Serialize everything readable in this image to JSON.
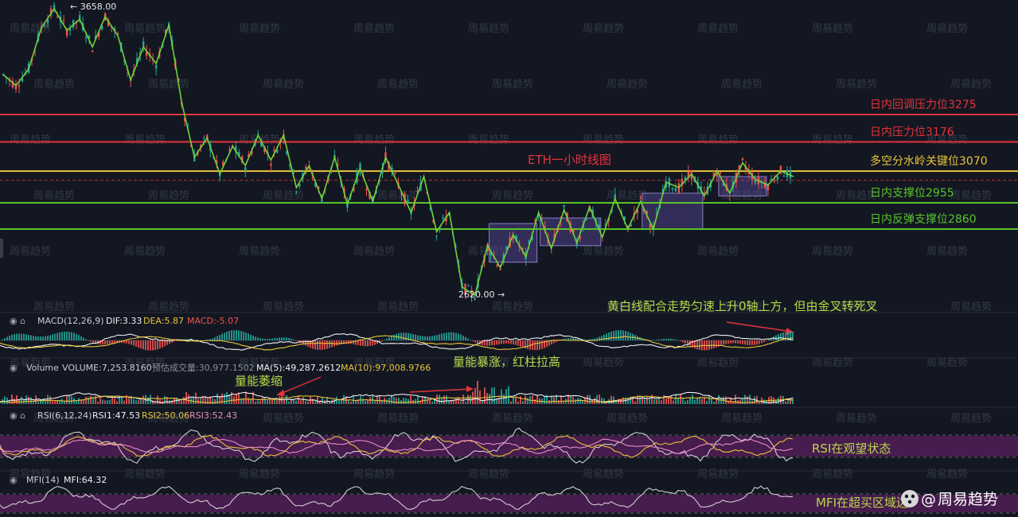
{
  "chart_data": {
    "type": "candlestick",
    "title": "ETH一小时线图",
    "price_extremes": {
      "high": "3658.00",
      "low": "2620.00"
    },
    "levels": [
      {
        "label": "日内回调压力位3275",
        "value": 3275,
        "color": "#e5333a"
      },
      {
        "label": "日内压力位3176",
        "value": 3176,
        "color": "#e5333a"
      },
      {
        "label": "多空分水岭关键位3070",
        "value": 3070,
        "color": "#e9c43a"
      },
      {
        "label": "日内支撑位2955",
        "value": 2955,
        "color": "#58c42a"
      },
      {
        "label": "日内反弹支撑位2860",
        "value": 2860,
        "color": "#58c42a"
      }
    ],
    "current_price": 3037,
    "price_path": [
      3420,
      3380,
      3440,
      3590,
      3658,
      3580,
      3620,
      3520,
      3630,
      3560,
      3400,
      3520,
      3460,
      3600,
      3320,
      3120,
      3190,
      3060,
      3160,
      3090,
      3200,
      3110,
      3200,
      3010,
      3090,
      2970,
      3120,
      2950,
      3080,
      2960,
      3120,
      3020,
      2920,
      3050,
      2850,
      2920,
      2650,
      2620,
      2800,
      2720,
      2840,
      2760,
      2920,
      2790,
      2930,
      2810,
      2940,
      2830,
      2970,
      2860,
      2960,
      2860,
      3030,
      3010,
      3060,
      2980,
      3070,
      2990,
      3100,
      3040,
      3020,
      3070,
      3050
    ],
    "consolidation_boxes": [
      {
        "start": 2740,
        "end": 2880
      },
      {
        "start": 2800,
        "end": 2900
      },
      {
        "start": 2860,
        "end": 2990
      },
      {
        "start": 2980,
        "end": 3050
      }
    ],
    "macd": {
      "params": "MACD(12,26,9)",
      "dif": "DIF:3.33",
      "dea": "DEA:5.87",
      "macd": "MACD:-5.07"
    },
    "volume": {
      "label": "Volume",
      "volume": "VOLUME:7,253.8160",
      "pred": "预估成交量:30,977.1502",
      "ma5": "MA(5):49,287.2612",
      "ma10": "MA(10):97,008.9766"
    },
    "rsi": {
      "params": "RSI(6,12,24)",
      "rsi1": "RSI1:47.53",
      "rsi2": "RSI2:50.06",
      "rsi3": "RSI3:52.43"
    },
    "mfi": {
      "params": "MFI(14)",
      "mfi": "MFI:64.32"
    },
    "annotations": {
      "macd_note": "黄白线配合走势匀速上升0轴上方，但由金叉转死叉",
      "volume_spike": "量能暴涨，红柱拉高",
      "volume_shrink": "量能萎缩",
      "rsi_note": "RSI在观望状态",
      "mfi_note": "MFI在超买区域边"
    },
    "colors": {
      "up": "#26a69a",
      "down": "#ef5350",
      "dif": "#f0f0f0",
      "dea": "#e9c43a",
      "box": "#5b4a9e"
    }
  },
  "watermark": "周易趋势",
  "brand": {
    "at": "@",
    "name": "周易趋势"
  }
}
